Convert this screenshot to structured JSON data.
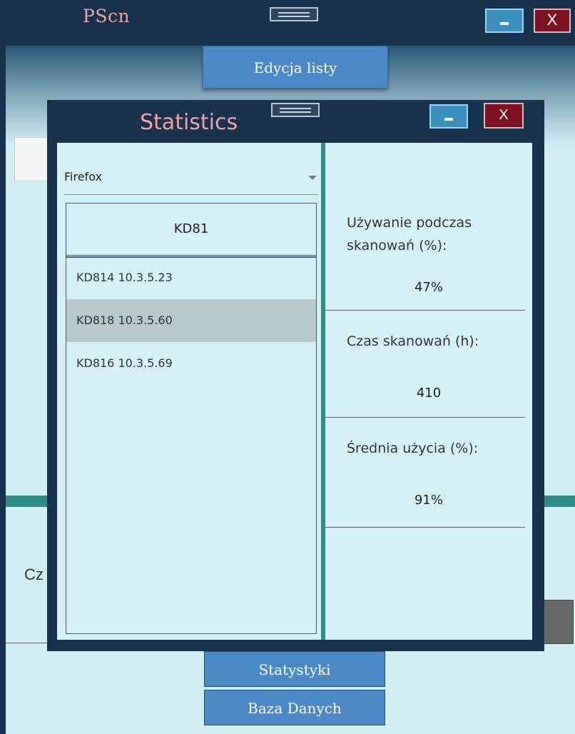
{
  "main_window": {
    "title": "PScn",
    "close_label": "X",
    "edit_list_button": "Edycja listy",
    "partial_label": "Cz",
    "stats_button": "Statystyki",
    "db_button": "Baza Danych"
  },
  "stats_window": {
    "title": "Statistics",
    "close_label": "X",
    "browser_select": {
      "selected": "Firefox"
    },
    "list": {
      "header": "KD81",
      "items": [
        {
          "label": "KD814 10.3.5.23",
          "selected": false
        },
        {
          "label": "KD818 10.3.5.60",
          "selected": true
        },
        {
          "label": "KD816 10.3.5.69",
          "selected": false
        }
      ]
    },
    "stats": {
      "usage_label": "Używanie podczas skanowań (%):",
      "usage_value": "47%",
      "time_label": "Czas skanowań (h):",
      "time_value": "410",
      "avg_label": "Średnia użycia (%):",
      "avg_value": "91%"
    }
  },
  "colors": {
    "titlebar": "#17324c",
    "title_text": "#f0a1a6",
    "accent_button": "#4a89c6",
    "teal_divider": "#2e8c86",
    "body_background": "#d4f2f5",
    "selected_row": "#b8c9cb",
    "close_button": "#7b1420"
  },
  "icons": [
    "drag-grip-icon",
    "minimize-icon",
    "close-icon",
    "dropdown-arrow-icon"
  ]
}
